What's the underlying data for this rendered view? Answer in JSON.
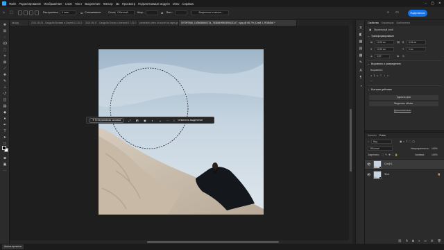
{
  "menu": {
    "items": [
      "Файл",
      "Редактирование",
      "Изображение",
      "Слои",
      "Текст",
      "Выделение",
      "Фильтр",
      "3D",
      "Просмотр",
      "Подключаемые модули",
      "Окно",
      "Справка"
    ]
  },
  "options_bar": {
    "feather_label": "Растушевка:",
    "feather_value": "0 пикс.",
    "antialias_label": "Сглаживание",
    "style_label": "Стиль:",
    "style_value": "Обычный",
    "width_label": "Шир.:",
    "height_label": "Выс.:",
    "select_mask_label": "Выделение и маска...",
    "share_label": "Поделиться"
  },
  "tabs": [
    {
      "label": "ыи.jpg",
      "active": false
    },
    {
      "label": "2021.05.25 - Свадьба Вслава и Сергей 12-02-23 8373.jpg",
      "active": false
    },
    {
      "label": "2021.05.17 - Свадьба Ольга и Алексей 17-21-07 5668.jpg",
      "active": false
    },
    {
      "label": "panoramic-view-of-sunset-at-night.jpg",
      "active": false
    },
    {
      "label": "007997966_1535088660724_7838849955399421147_n.jpg @ 66,7% (Слой 1, RGB/8#) *",
      "active": true
    }
  ],
  "context_bar": {
    "generative_fill": "Генеративная заливка",
    "deselect": "Отменить выделение"
  },
  "properties": {
    "tabs": [
      "Свойства",
      "Коррекция",
      "Библиотеки"
    ],
    "layer_type": "Пиксельный слой",
    "section_transform": "Трансформирование",
    "w_value": "10,98 см",
    "h_value": "6,94 см",
    "x_value": "10,98 см",
    "y_value": "0 см",
    "angle_value": "0,00°",
    "section_align": "Выровнять и распределить",
    "align_label": "Выровнять:",
    "section_quick": "Быстрые действия",
    "btn_remove_bg": "Удалить фон",
    "btn_select_subject": "Выделить объект",
    "link_more": "Дополнительно"
  },
  "layers": {
    "tabs": [
      "Каналы",
      "Слои"
    ],
    "filter_label": "Вид",
    "blend_mode": "Обычные",
    "opacity_label": "Непрозрачность:",
    "opacity_value": "100%",
    "lock_label": "Закрепить:",
    "fill_label": "Заливка:",
    "fill_value": "100%",
    "items": [
      {
        "name": "Слой 1",
        "selected": true
      },
      {
        "name": "Фон",
        "selected": false
      }
    ]
  },
  "status": {
    "label": "Шкала времени"
  },
  "colors": {
    "accent": "#1473e6",
    "panel_bg": "#2b2b2b",
    "canvas_bg": "#1e1e1e"
  },
  "icons": {
    "toolbar": [
      "move-tool-icon",
      "artboard-icon",
      "marquee-icon",
      "lasso-icon",
      "object-select-icon",
      "crop-icon",
      "frame-icon",
      "eyedropper-icon",
      "healing-icon",
      "brush-icon",
      "clone-stamp-icon",
      "history-brush-icon",
      "eraser-icon",
      "gradient-icon",
      "blur-icon",
      "dodge-icon",
      "pen-icon",
      "type-icon",
      "path-select-icon",
      "rectangle-icon",
      "hand-icon",
      "zoom-icon",
      "more-tools-icon"
    ]
  }
}
